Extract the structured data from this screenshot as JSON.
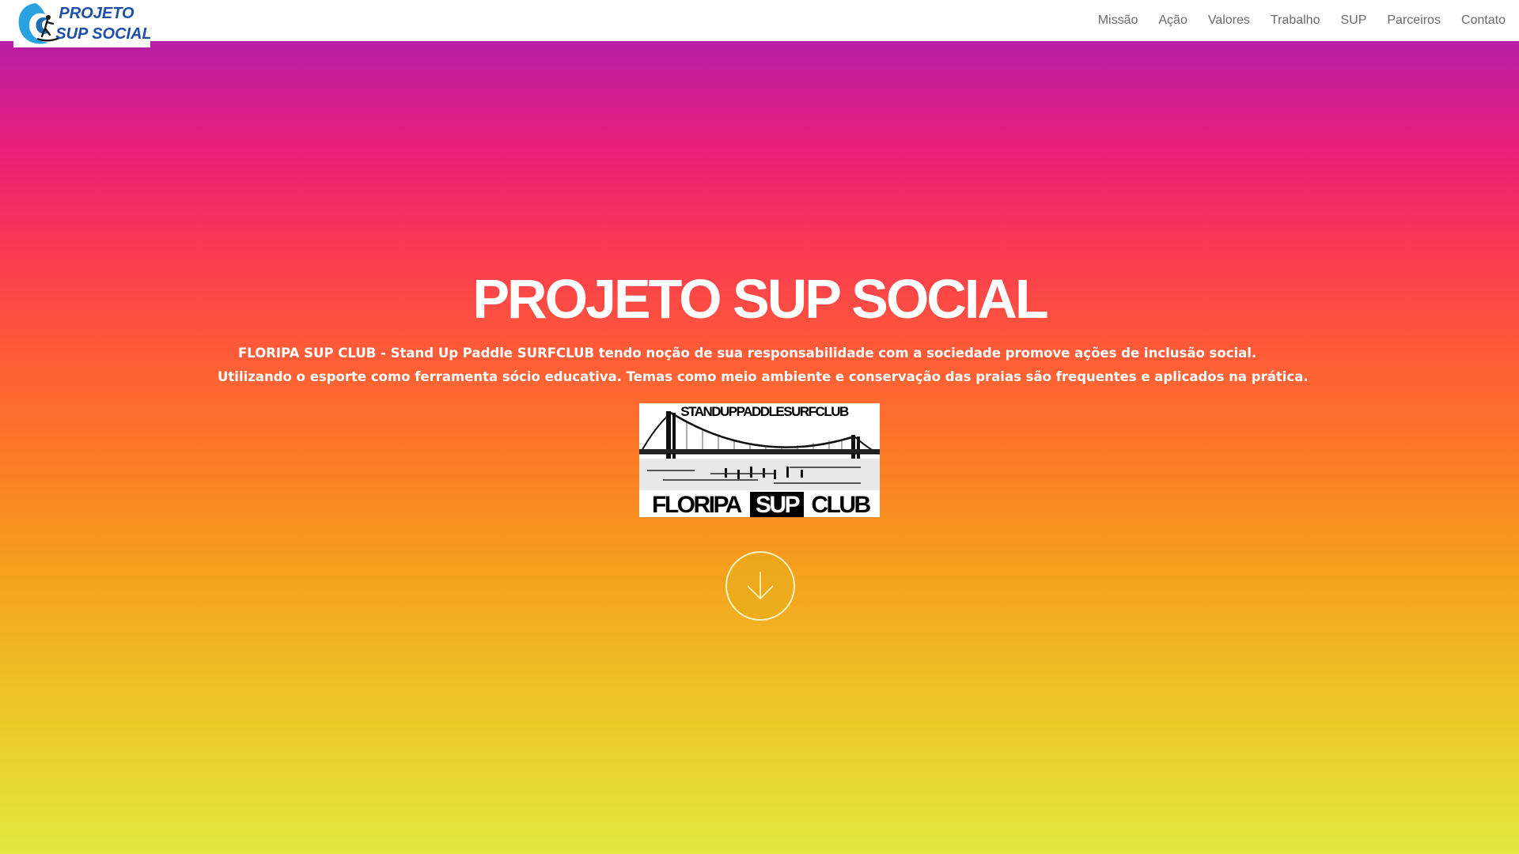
{
  "brand": {
    "logo_line1": "PROJETO",
    "logo_line2": "SUP SOCIAL",
    "logo_color": "#1d4fa8",
    "icon": "surfer-wave-icon"
  },
  "nav": {
    "items": [
      {
        "label": "Missão"
      },
      {
        "label": "Ação"
      },
      {
        "label": "Valores"
      },
      {
        "label": "Trabalho"
      },
      {
        "label": "SUP"
      },
      {
        "label": "Parceiros"
      },
      {
        "label": "Contato"
      }
    ]
  },
  "hero": {
    "title": "PROJETO SUP SOCIAL",
    "description": "FLORIPA SUP CLUB - Stand Up Paddle SURFCLUB tendo noção de sua responsabilidade com a sociedade promove ações de inclusão social. Utilizando o esporte como ferramenta sócio educativa. Temas como meio ambiente e conservação das praias são frequentes e aplicados na prática.",
    "banner": {
      "top_text": "STANDUPPADDLESURFCLUB",
      "bottom_text_left": "FLORIPA",
      "bottom_text_mid": "SUP",
      "bottom_text_right": "CLUB"
    },
    "scroll_icon": "arrow-down-icon",
    "gradient_colors": [
      "#b61ea7",
      "#e91e79",
      "#fa3a52",
      "#fe5a38",
      "#fb7c25",
      "#f5a01e",
      "#efbe22",
      "#e7d62f",
      "#e2e83c"
    ]
  }
}
